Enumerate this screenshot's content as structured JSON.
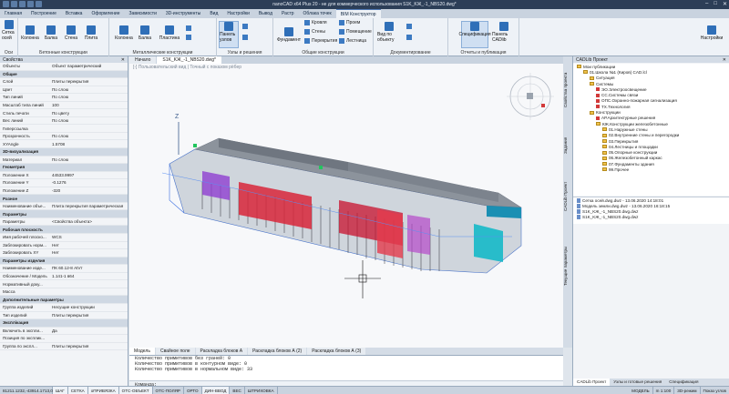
{
  "titlebar": {
    "title": "nanoCAD x64 Plus 20 - не для коммерческого использования S1K_KЖ_-1_NBS20.dwg*"
  },
  "menu": {
    "tabs": [
      "Главная",
      "Построение",
      "Вставка",
      "Оформление",
      "Зависимости",
      "3D-инструменты",
      "Вид",
      "Настройки",
      "Вывод",
      "Растр",
      "Облака точек",
      "BIM Конструктор"
    ]
  },
  "ribbon": {
    "groups": {
      "axes": "Оси",
      "concrete": "Бетонные конструкции",
      "metal": "Металлические конструкции",
      "nodes": "Узлы и решения",
      "general": "Общие конструкции",
      "docs": "Документирование",
      "reports": "Отчеты и публикация"
    },
    "buttons": {
      "grid": "Сетка осей",
      "column": "Колонна",
      "beam": "Балка",
      "wall": "Стена",
      "slab": "Плита",
      "plate": "Пластина",
      "node_panel": "Панель узлов",
      "roof": "Кровля",
      "walls": "Стены",
      "floors": "Перекрытия",
      "foundation": "Фундамент",
      "opening": "Проем",
      "room": "Помещение",
      "stair": "Лестница",
      "view_by_obj": "Вид по объекту",
      "specification": "Спецификация",
      "cadlib_panel": "Панель CADlib",
      "settings": "Настройки"
    }
  },
  "properties": {
    "title": "Свойства",
    "object_label": "Объекты",
    "object_value": "Объект параметрический",
    "rows": [
      {
        "k": "Общие",
        "v": "",
        "cat": true
      },
      {
        "k": "Слой",
        "v": "Плиты перекрытия"
      },
      {
        "k": "Цвет",
        "v": "По слою"
      },
      {
        "k": "Тип линий",
        "v": "По слою"
      },
      {
        "k": "Масштаб типа линий",
        "v": "100"
      },
      {
        "k": "Стиль печати",
        "v": "По цвету"
      },
      {
        "k": "Вес линий",
        "v": "По слою"
      },
      {
        "k": "Гиперссылка",
        "v": ""
      },
      {
        "k": "Прозрачность",
        "v": "По слою"
      },
      {
        "k": "XYAngle",
        "v": "1.5708"
      },
      {
        "k": "3D-визуализация",
        "v": "",
        "cat": true
      },
      {
        "k": "Материал",
        "v": "По слою"
      },
      {
        "k": "Геометрия",
        "v": "",
        "cat": true
      },
      {
        "k": "Положение X",
        "v": "44533.9997"
      },
      {
        "k": "Положение Y",
        "v": "-0.1276"
      },
      {
        "k": "Положение Z",
        "v": "-320"
      },
      {
        "k": "Разное",
        "v": "",
        "cat": true
      },
      {
        "k": "Наименование объе...",
        "v": "Плита перекрытия параметрическая"
      },
      {
        "k": "Параметры",
        "v": "",
        "cat": true
      },
      {
        "k": "Параметры",
        "v": "<Свойства объекта>"
      },
      {
        "k": "Рабочая плоскость",
        "v": "",
        "cat": true
      },
      {
        "k": "Имя рабочей плоско...",
        "v": "WCS"
      },
      {
        "k": "Заблокировать норм...",
        "v": "Нет"
      },
      {
        "k": "Заблокировать XY",
        "v": "Нет"
      },
      {
        "k": "Параметры изделия",
        "v": "",
        "cat": true
      },
      {
        "k": "Наименование изде...",
        "v": "ПК 60.12-8 AtVт"
      },
      {
        "k": "Обозначение / Модель",
        "v": "1.141-1 в64"
      },
      {
        "k": "Нормативный доку...",
        "v": ""
      },
      {
        "k": "Масса",
        "v": ""
      },
      {
        "k": "Дополнительные параметры",
        "v": "",
        "cat": true
      },
      {
        "k": "Группа изделий",
        "v": "Несущие конструкции"
      },
      {
        "k": "Тип изделий",
        "v": "Плиты перекрытия"
      },
      {
        "k": "Эксплікация",
        "v": "",
        "cat": true
      },
      {
        "k": "Включить в экспли...",
        "v": "Да"
      },
      {
        "k": "Позиция по эксплик...",
        "v": ""
      },
      {
        "k": "Группа по экспл...",
        "v": "Плиты перекрытия"
      }
    ]
  },
  "doc_tabs": [
    "Начало",
    "S1K_KЖ_-1_NBS20.dwg*"
  ],
  "viewport": {
    "header": "[-] Пользовательский вид | Точный с показом рёбер",
    "z_label": "Z"
  },
  "layout_tabs": [
    "Модель",
    "Свайное поле",
    "Раскладка блоков А",
    "Раскладка блоков А (2)",
    "Раскладка блоков А (3)"
  ],
  "command": {
    "lines": [
      "Количество примитивов без граней: 0",
      "Количество примитивов в контурном виде: 0",
      "Количество примитивов в нормальном виде: 33"
    ],
    "prompt": "Команда:"
  },
  "side_tabs": [
    "Свойства проекта",
    "Задания",
    "CADLib Проект",
    "Текущие параметры"
  ],
  "cadlib": {
    "title": "CADLib Проект",
    "tree": [
      {
        "label": "Мои публикации",
        "lvl": 0,
        "t": "f"
      },
      {
        "label": "01.Школа №1 (Киров) CAD.lcl",
        "lvl": 1,
        "t": "f"
      },
      {
        "label": "Ситуация",
        "lvl": 2,
        "t": "f"
      },
      {
        "label": "Системы",
        "lvl": 2,
        "t": "f"
      },
      {
        "label": "ЭО.Электроосвещение",
        "lvl": 3,
        "t": "r"
      },
      {
        "label": "СС.Системы связи",
        "lvl": 3,
        "t": "r"
      },
      {
        "label": "ОПС.Охранно-пожарная сигнализация",
        "lvl": 3,
        "t": "r"
      },
      {
        "label": "ТХ.Технология",
        "lvl": 3,
        "t": "r"
      },
      {
        "label": "Конструкции",
        "lvl": 2,
        "t": "f"
      },
      {
        "label": "АР.Архитектурные решения",
        "lvl": 3,
        "t": "r"
      },
      {
        "label": "КЖ.Конструкции железобетонные",
        "lvl": 3,
        "t": "f"
      },
      {
        "label": "01.Наружные стены",
        "lvl": 4,
        "t": "f"
      },
      {
        "label": "02.Внутренние стены и перегородки",
        "lvl": 4,
        "t": "f"
      },
      {
        "label": "03.Перекрытия",
        "lvl": 4,
        "t": "f"
      },
      {
        "label": "04.Лестницы и площадки",
        "lvl": 4,
        "t": "f"
      },
      {
        "label": "05.Опорные конструкции",
        "lvl": 4,
        "t": "f"
      },
      {
        "label": "06.Железобетонный каркас",
        "lvl": 4,
        "t": "f"
      },
      {
        "label": "07.Фундаменты здания",
        "lvl": 4,
        "t": "f"
      },
      {
        "label": "99.Прочее",
        "lvl": 4,
        "t": "f"
      }
    ],
    "files": [
      "Сетка осей.dwg.dwz - 13.06.2020 14:18:01",
      "Модель земли.dwg.dwz - 13.06.2020 16:18:15",
      "S1K_KЖ_-1_NBS20.dwg.dwz",
      "S1K_KЖ_-1_NBS20.dwg.dwz"
    ],
    "tabs": [
      "CADLib Проект",
      "Узлы и готовые решения",
      "Спецификация"
    ]
  },
  "status": {
    "coords": "81211.1232,-43914.1713,0.000",
    "toggles": [
      "ШАГ",
      "СЕТКА",
      "оПРИВЯЗКА",
      "ОТС-ОБЪЕКТ",
      "ОТС-ПОЛЯР",
      "ОРТО",
      "ДИН-ВВОД",
      "ВЕС",
      "ШТРИХОВКА"
    ],
    "model": "МОДЕЛЬ",
    "scale": "m 1:100",
    "right": [
      "3D-режим",
      "Показ углов"
    ]
  },
  "colors": {
    "accent": "#2f6fb8",
    "title_bg": "#2c3e57"
  }
}
